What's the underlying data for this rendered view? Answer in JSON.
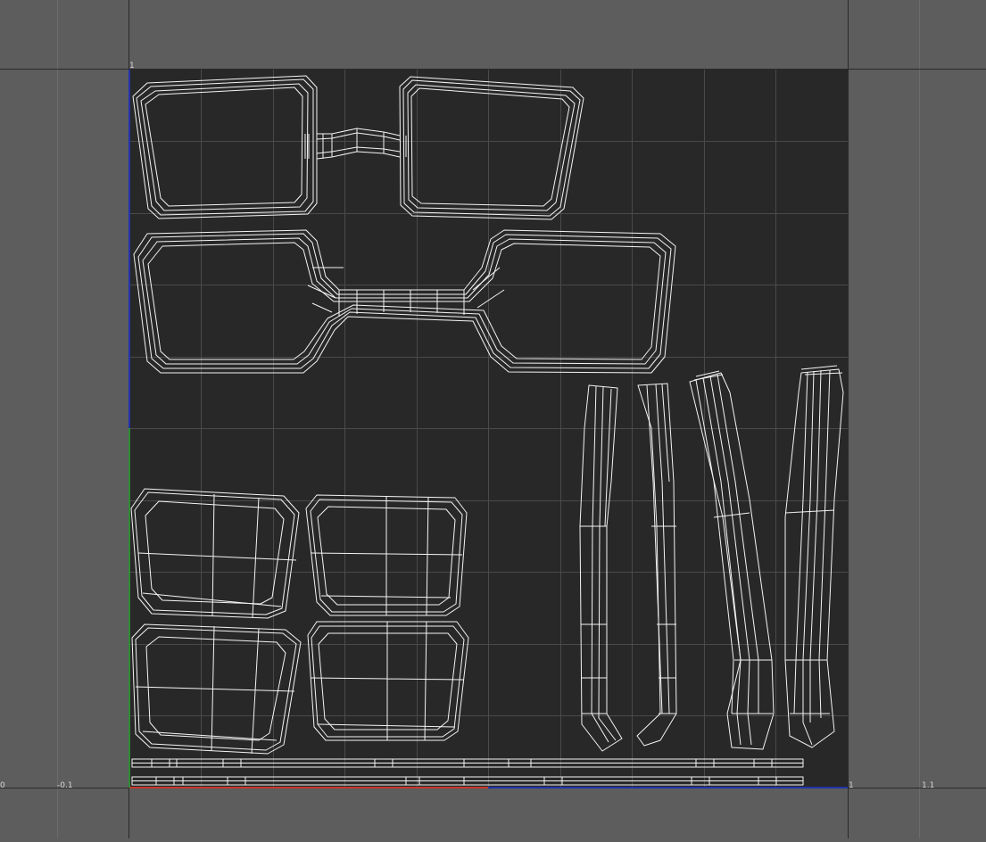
{
  "window": {
    "title": ""
  },
  "uv_editor": {
    "axis_labels": {
      "x_neg": "-0.1",
      "x_zero": "0",
      "x_one": "1",
      "x_pos": "1.1",
      "y_one": "1"
    },
    "colors": {
      "background": "#5d5d5d",
      "uv_tile": "#282828",
      "grid_minor": "#4a4a4a",
      "grid_major": "#2a2a2a",
      "wire": "#f4f4f4",
      "axis_u": "#c8372d",
      "axis_v": "#2e8b35",
      "axis_blue": "#2233aa"
    },
    "grid": {
      "visible": true,
      "divisions": 10
    },
    "shells": [
      {
        "name": "frame-front-top",
        "kind": "glasses-frame"
      },
      {
        "name": "frame-front-bottom",
        "kind": "glasses-frame"
      },
      {
        "name": "temple-arm-1",
        "kind": "strip"
      },
      {
        "name": "temple-arm-2",
        "kind": "strip"
      },
      {
        "name": "temple-arm-3",
        "kind": "strip"
      },
      {
        "name": "temple-arm-4",
        "kind": "strip"
      },
      {
        "name": "lens-1",
        "kind": "lens"
      },
      {
        "name": "lens-2",
        "kind": "lens"
      },
      {
        "name": "lens-3",
        "kind": "lens"
      },
      {
        "name": "lens-4",
        "kind": "lens"
      },
      {
        "name": "rim-strip-1",
        "kind": "long-strip"
      },
      {
        "name": "rim-strip-2",
        "kind": "long-strip"
      }
    ]
  }
}
